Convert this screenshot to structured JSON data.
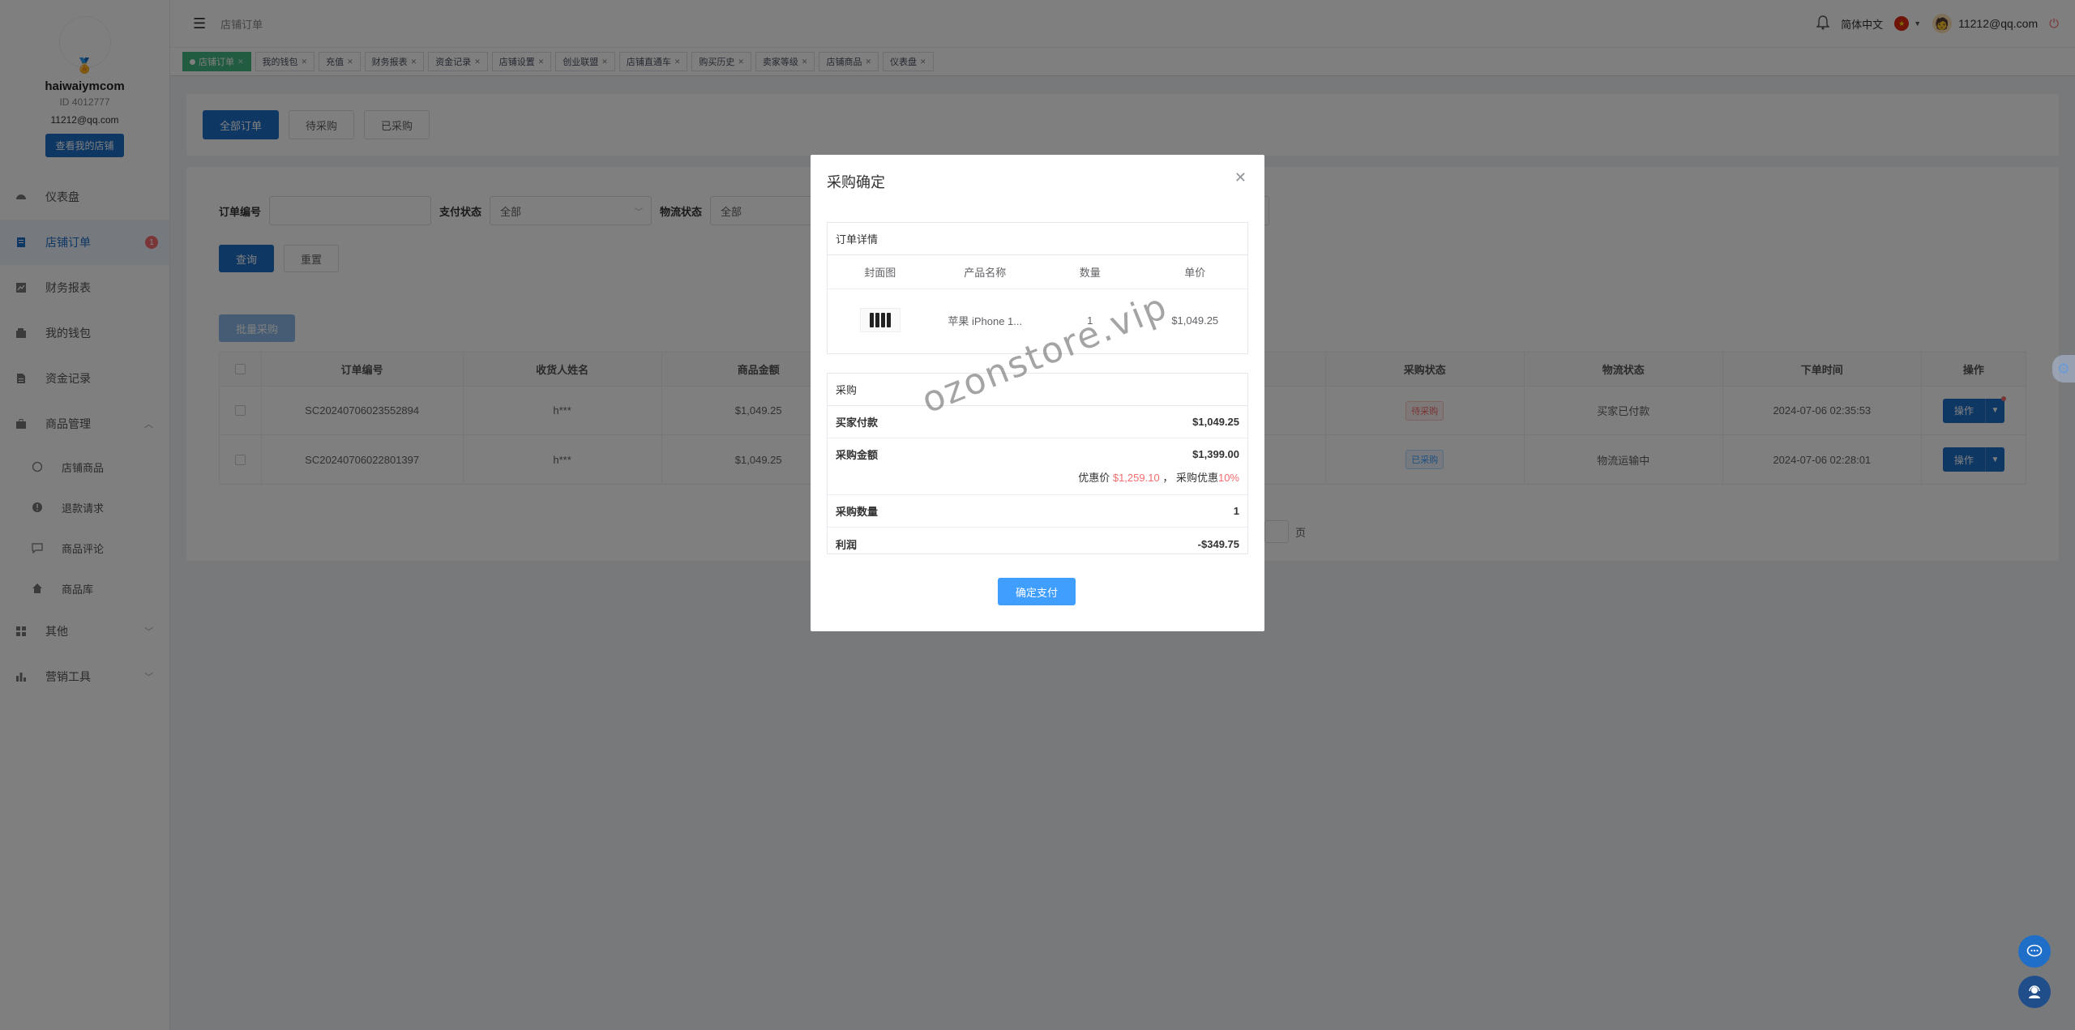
{
  "profile": {
    "username": "haiwaiymcom",
    "id": "ID 4012777",
    "email": "11212@qq.com",
    "shop_button": "查看我的店铺"
  },
  "sidebar": {
    "items": [
      {
        "label": "仪表盘",
        "icon": "dashboard-icon"
      },
      {
        "label": "店铺订单",
        "icon": "order-icon",
        "count": "1"
      },
      {
        "label": "财务报表",
        "icon": "report-icon"
      },
      {
        "label": "我的钱包",
        "icon": "wallet-icon"
      },
      {
        "label": "资金记录",
        "icon": "record-icon"
      },
      {
        "label": "商品管理",
        "icon": "briefcase-icon"
      }
    ],
    "sub_items": [
      {
        "label": "店铺商品",
        "icon": "circle-icon"
      },
      {
        "label": "退款请求",
        "icon": "info-icon"
      },
      {
        "label": "商品评论",
        "icon": "comment-icon"
      },
      {
        "label": "商品库",
        "icon": "home-icon"
      }
    ],
    "extra_items": [
      {
        "label": "其他",
        "icon": "grid-icon"
      },
      {
        "label": "营销工具",
        "icon": "bar-chart-icon"
      }
    ]
  },
  "header": {
    "breadcrumb": "店铺订单",
    "language": "简体中文",
    "user_email": "11212@qq.com"
  },
  "tags": [
    "店铺订单",
    "我的钱包",
    "充值",
    "财务报表",
    "资金记录",
    "店铺设置",
    "创业联盟",
    "店铺直通车",
    "购买历史",
    "卖家等级",
    "店铺商品",
    "仪表盘"
  ],
  "order_tabs": [
    "全部订单",
    "待采购",
    "已采购"
  ],
  "filters": {
    "order_no_label": "订单编号",
    "pay_status_label": "支付状态",
    "pay_status_value": "全部",
    "logistics_label": "物流状态",
    "logistics_value": "全部",
    "query": "查询",
    "reset": "重置",
    "batch": "批量采购"
  },
  "table": {
    "headers": {
      "order_no": "订单编号",
      "recipient": "收货人姓名",
      "amount": "商品金额",
      "purchase_status": "采购状态",
      "logistics_status": "物流状态",
      "order_time": "下单时间",
      "action": "操作"
    },
    "rows": [
      {
        "order_no": "SC20240706023552894",
        "recipient": "h***",
        "amount": "$1,049.25",
        "purchase_status": "待采购",
        "logistics_status": "买家已付款",
        "order_time": "2024-07-06 02:35:53",
        "action": "操作"
      },
      {
        "order_no": "SC20240706022801397",
        "recipient": "h***",
        "amount": "$1,049.25",
        "purchase_status": "已采购",
        "logistics_status": "物流运输中",
        "order_time": "2024-07-06 02:28:01",
        "action": "操作"
      }
    ],
    "pager_suffix": "页"
  },
  "modal": {
    "title": "采购确定",
    "detail_title": "订单详情",
    "detail_headers": {
      "cover": "封面图",
      "name": "产品名称",
      "qty": "数量",
      "price": "单价"
    },
    "product": {
      "name": "苹果 iPhone 1...",
      "qty": "1",
      "price": "$1,049.25"
    },
    "purchase_title": "采购",
    "buyer_paid_label": "买家付款",
    "buyer_paid_value": "$1,049.25",
    "purchase_amount_label": "采购金额",
    "purchase_amount_value": "$1,399.00",
    "discount_price_label": "优惠价",
    "discount_price_value": "$1,259.10",
    "discount_sep": "，",
    "discount_rate_label": "采购优惠",
    "discount_rate_value": "10%",
    "purchase_qty_label": "采购数量",
    "purchase_qty_value": "1",
    "profit_label": "利润",
    "profit_value": "-$349.75",
    "confirm_button": "确定支付",
    "watermark": "ozonstore.vip"
  }
}
